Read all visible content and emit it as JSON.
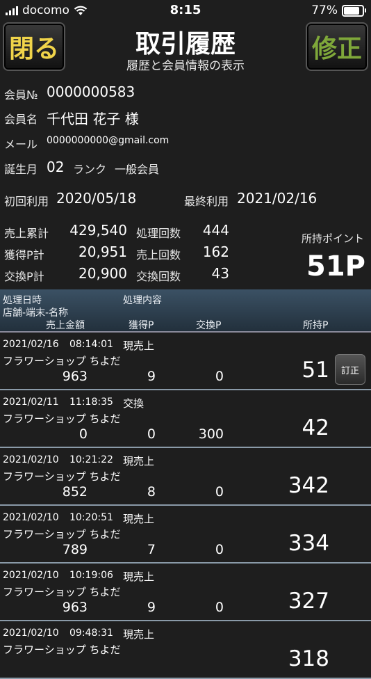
{
  "status": {
    "carrier": "docomo",
    "time": "8:15",
    "battery": "77%",
    "battery_level": 0.77
  },
  "header": {
    "close_label": "閉る",
    "edit_label": "修正",
    "title": "取引履歴",
    "subtitle": "履歴と会員情報の表示"
  },
  "member": {
    "no_label": "会員№",
    "no": "0000000583",
    "name_label": "会員名",
    "name": "千代田 花子 様",
    "mail_label": "メール",
    "mail": "0000000000@gmail.com",
    "birth_label": "誕生月",
    "birth": "02",
    "rank_label": "ランク",
    "rank": "一般会員",
    "first_label": "初回利用",
    "first": "2020/05/18",
    "last_label": "最終利用",
    "last": "2021/02/16"
  },
  "stats": {
    "sales_total_label": "売上累計",
    "sales_total": "429,540",
    "process_count_label": "処理回数",
    "process_count": "444",
    "earned_label": "獲得P計",
    "earned": "20,951",
    "sales_count_label": "売上回数",
    "sales_count": "162",
    "exchange_label": "交換P計",
    "exchange": "20,900",
    "exchange_count_label": "交換回数",
    "exchange_count": "43",
    "points_label": "所持ポイント",
    "points": "51P"
  },
  "table": {
    "h_datetime": "処理日時",
    "h_content": "処理内容",
    "h_shop": "店舗-端末-名称",
    "h_sales": "売上金額",
    "h_earned": "獲得P",
    "h_exchange": "交換P",
    "h_held": "所持P",
    "fix_label": "訂正",
    "rows": [
      {
        "date": "2021/02/16",
        "time": "08:14:01",
        "kind": "現売上",
        "shop": "フラワーショップ ちよだ",
        "sales": "963",
        "earned": "9",
        "exchange": "0",
        "held": "51"
      },
      {
        "date": "2021/02/11",
        "time": "11:18:35",
        "kind": "交換",
        "shop": "フラワーショップ ちよだ",
        "sales": "0",
        "earned": "0",
        "exchange": "300",
        "held": "42"
      },
      {
        "date": "2021/02/10",
        "time": "10:21:22",
        "kind": "現売上",
        "shop": "フラワーショップ ちよだ",
        "sales": "852",
        "earned": "8",
        "exchange": "0",
        "held": "342"
      },
      {
        "date": "2021/02/10",
        "time": "10:20:51",
        "kind": "現売上",
        "shop": "フラワーショップ ちよだ",
        "sales": "789",
        "earned": "7",
        "exchange": "0",
        "held": "334"
      },
      {
        "date": "2021/02/10",
        "time": "10:19:06",
        "kind": "現売上",
        "shop": "フラワーショップ ちよだ",
        "sales": "963",
        "earned": "9",
        "exchange": "0",
        "held": "327"
      },
      {
        "date": "2021/02/10",
        "time": "09:48:31",
        "kind": "現売上",
        "shop": "フラワーショップ ちよだ",
        "sales": "",
        "earned": "",
        "exchange": "",
        "held": "318"
      }
    ]
  }
}
